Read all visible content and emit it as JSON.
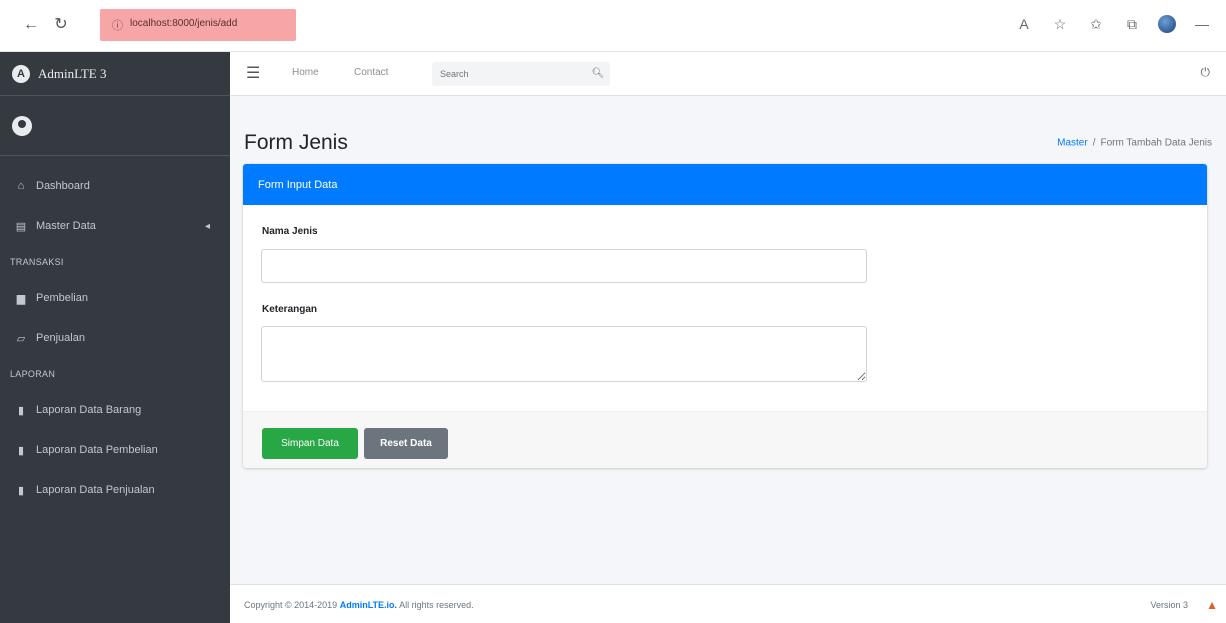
{
  "browser": {
    "url": "localhost:8000/jenis/add",
    "url_host": "localhost",
    "icons": [
      "back-arrow-icon",
      "refresh-icon",
      "info-icon",
      "read-aloud-icon",
      "favorite-icon",
      "favorites-list-icon",
      "collections-icon",
      "profile-avatar",
      "minimize-icon"
    ]
  },
  "sidebar": {
    "brand": "AdminLTE 3",
    "items": [
      {
        "label": "Dashboard",
        "icon": "home-icon"
      },
      {
        "label": "Master Data",
        "icon": "table-icon",
        "arrow": "◂"
      }
    ],
    "section_transaksi": "TRANSAKSI",
    "transaksi_items": [
      {
        "label": "Pembelian",
        "icon": "shopping-bag-icon"
      },
      {
        "label": "Penjualan",
        "icon": "folder-open-icon"
      }
    ],
    "section_laporan": "LAPORAN",
    "laporan_items": [
      {
        "label": "Laporan Data Barang",
        "icon": "file-icon"
      },
      {
        "label": "Laporan Data Pembelian",
        "icon": "file-icon"
      },
      {
        "label": "Laporan Data Penjualan",
        "icon": "file-icon"
      }
    ]
  },
  "topbar": {
    "home": "Home",
    "contact": "Contact",
    "search_placeholder": "Search"
  },
  "page": {
    "title": "Form Jenis",
    "breadcrumb_link": "Master",
    "breadcrumb_current": "Form Tambah Data Jenis"
  },
  "card": {
    "header": "Form Input Data",
    "label_nama": "Nama Jenis",
    "nama_value": "",
    "label_keterangan": "Keterangan",
    "keterangan_value": "",
    "save_label": "Simpan Data",
    "reset_label": "Reset Data"
  },
  "footer": {
    "copyright_prefix": "Copyright © 2014-2019",
    "brand_link": "AdminLTE.io.",
    "copyright_suffix": "All rights reserved.",
    "version": "Version 3"
  },
  "colors": {
    "primary": "#007bff",
    "success": "#28a745",
    "secondary": "#6c757d",
    "sidebar": "#343a40",
    "url_highlight": "#f6a6a6"
  }
}
